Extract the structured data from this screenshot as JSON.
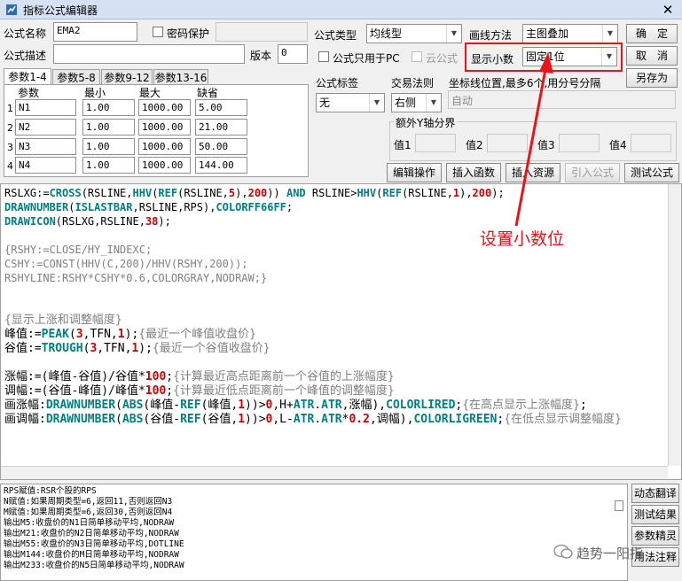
{
  "window": {
    "title": "指标公式编辑器",
    "close_glyph": "✕"
  },
  "form": {
    "name_label": "公式名称",
    "name_value": "EMA2",
    "password_label": "密码保护",
    "desc_label": "公式描述",
    "desc_value": "",
    "version_label": "版本",
    "version_value": "0",
    "type_label": "公式类型",
    "type_value": "均线型",
    "draw_label": "画线方法",
    "draw_value": "主图叠加",
    "pc_only_label": "公式只用于PC",
    "cloud_label": "云公式",
    "decimal_label": "显示小数",
    "decimal_value": "固定1位",
    "tag_label": "公式标签",
    "tag_value": "无",
    "trade_label": "交易法则",
    "trade_value": "右侧",
    "coord_label": "坐标线位置,最多6个,用分号分隔",
    "coord_value": "自动",
    "yaxis_group": "额外Y轴分界",
    "yaxis_labels": [
      "值1",
      "值2",
      "值3",
      "值4"
    ]
  },
  "buttons": {
    "ok": "确　定",
    "cancel": "取　消",
    "save_as": "另存为",
    "edit_ops": "编辑操作",
    "insert_func": "插入函数",
    "insert_res": "插入资源",
    "import": "引入公式",
    "test": "测试公式",
    "dyn_translate": "动态翻译",
    "test_result": "测试结果",
    "param_tune": "参数精灵",
    "usage_note": "用法注释"
  },
  "tabs": [
    "参数1-4",
    "参数5-8",
    "参数9-12",
    "参数13-16"
  ],
  "params": {
    "headers": [
      "参数",
      "最小",
      "最大",
      "缺省"
    ],
    "rows": [
      {
        "idx": "1",
        "name": "N1",
        "min": "1.00",
        "max": "1000.00",
        "def": "5.00"
      },
      {
        "idx": "2",
        "name": "N2",
        "min": "1.00",
        "max": "1000.00",
        "def": "21.00"
      },
      {
        "idx": "3",
        "name": "N3",
        "min": "1.00",
        "max": "1000.00",
        "def": "50.00"
      },
      {
        "idx": "4",
        "name": "N4",
        "min": "1.00",
        "max": "1000.00",
        "def": "144.00"
      }
    ]
  },
  "annotation": {
    "text": "设置小数位",
    "color": "#e8141c"
  },
  "code": {
    "l1": [
      "RSLXG:=",
      "CROSS",
      "(RSLINE,",
      "HHV",
      "(",
      "REF",
      "(RSLINE,",
      "5",
      "),",
      "200",
      ")) ",
      "AND",
      " RSLINE>",
      "HHV",
      "(",
      "REF",
      "(RSLINE,",
      "1",
      "),",
      "200",
      ");"
    ],
    "l2": [
      "DRAWNUMBER",
      "(",
      "ISLASTBAR",
      ",RSLINE,RPS),",
      "COLORFF66FF",
      ";"
    ],
    "l3": [
      "DRAWICON",
      "(RSLXG,RSLINE,",
      "38",
      ");"
    ],
    "l4": "{RSHY:=CLOSE/HY_INDEXC;",
    "l5": "CSHY:=CONST(HHV(C,200)/HHV(RSHY,200));",
    "l6": "RSHYLINE:RSHY*CSHY*0.6,COLORGRAY,NODRAW;}",
    "l7": "{显示上涨和调整幅度}",
    "l8": [
      "峰值:=",
      "PEAK",
      "(",
      "3",
      ",TFN,",
      "1",
      ");",
      "{最近一个峰值收盘价}"
    ],
    "l9": [
      "谷值:=",
      "TROUGH",
      "(",
      "3",
      ",TFN,",
      "1",
      ");",
      "{最近一个谷值收盘价}"
    ],
    "l10": [
      "涨幅:=(峰值-谷值)/谷值*",
      "100",
      ";",
      "{计算最近高点距离前一个谷值的上涨幅度}"
    ],
    "l11": [
      "调幅:=(谷值-峰值)/峰值*",
      "100",
      ";",
      "{计算最近低点距离前一个峰值的调整幅度}"
    ],
    "l12": [
      "画涨幅:",
      "DRAWNUMBER",
      "(",
      "ABS",
      "(峰值-",
      "REF",
      "(峰值,",
      "1",
      "))>",
      "0",
      ",H+",
      "ATR",
      ".",
      "ATR",
      ",涨幅),",
      "COLORLIRED",
      ";",
      "{在高点显示上涨幅度}",
      ";"
    ],
    "l13": [
      "画调幅:",
      "DRAWNUMBER",
      "(",
      "ABS",
      "(谷值-",
      "REF",
      "(谷值,",
      "1",
      "))>",
      "0",
      ",L-",
      "ATR",
      ".",
      "ATR",
      "*",
      "0.2",
      ",调幅),",
      "COLORLIGREEN",
      ";",
      "{在低点显示调整幅度}"
    ]
  },
  "description": [
    "RPS赋值:RSR个股的RPS",
    "N赋值:如果周期类型=6,返回11,否则返回N3",
    "M赋值:如果周期类型=6,返回30,否则返回N4",
    "输出M5:收盘价的N1日简单移动平均,NODRAW",
    "输出M21:收盘价的N2日简单移动平均,NODRAW",
    "输出M55:收盘价的N3日简单移动平均,DOTLINE",
    "输出M144:收盘价的M日简单移动平均,NODRAW",
    "输出M233:收盘价的N5日简单移动平均,NODRAW"
  ],
  "watermark": "趋势一阳指"
}
